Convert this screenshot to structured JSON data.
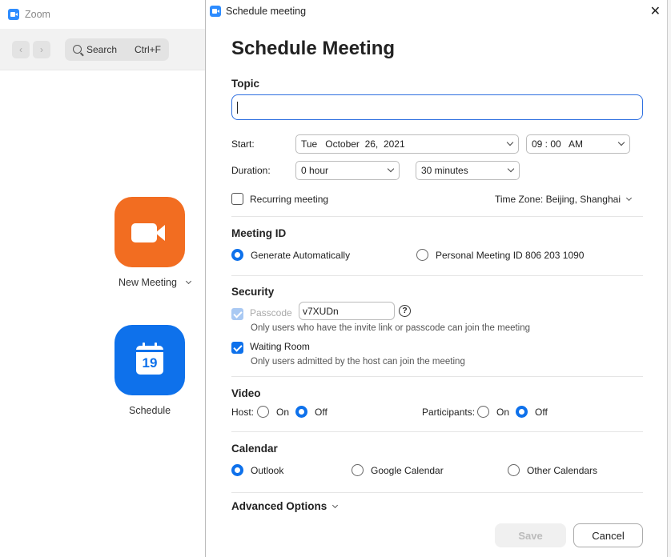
{
  "background_app": {
    "title": "Zoom",
    "search_label": "Search",
    "search_shortcut": "Ctrl+F",
    "back_icon": "chevron-left-icon",
    "forward_icon": "chevron-right-icon",
    "new_meeting_label": "New Meeting",
    "new_meeting_color": "#f26d21",
    "schedule_label": "Schedule",
    "schedule_color": "#0e71eb",
    "calendar_day": "19"
  },
  "dialog": {
    "window_title": "Schedule meeting",
    "close_glyph": "✕",
    "heading": "Schedule Meeting",
    "topic": {
      "label": "Topic",
      "value": ""
    },
    "start": {
      "label": "Start:",
      "date": "Tue   October  26,  2021",
      "time": "09 : 00   AM"
    },
    "duration": {
      "label": "Duration:",
      "hours": "0 hour",
      "minutes": "30 minutes"
    },
    "recurring": {
      "label": "Recurring meeting",
      "checked": false
    },
    "timezone": "Time Zone: Beijing, Shanghai",
    "meeting_id": {
      "label": "Meeting ID",
      "auto": "Generate Automatically",
      "personal": "Personal Meeting ID 806 203 1090",
      "selected": "auto"
    },
    "security": {
      "label": "Security",
      "passcode_label": "Passcode",
      "passcode_value": "v7XUDn",
      "passcode_help": "?",
      "passcode_hint": "Only users who have the invite link or passcode can join the meeting",
      "waiting_room_label": "Waiting Room",
      "waiting_room_hint": "Only users admitted by the host can join the meeting"
    },
    "video": {
      "label": "Video",
      "host_label": "Host:",
      "participants_label": "Participants:",
      "on": "On",
      "off": "Off",
      "host": "off",
      "participants": "off"
    },
    "calendar": {
      "label": "Calendar",
      "outlook": "Outlook",
      "google": "Google Calendar",
      "other": "Other Calendars",
      "selected": "outlook"
    },
    "advanced": "Advanced Options",
    "save_label": "Save",
    "cancel_label": "Cancel",
    "accent_color": "#0e71eb"
  }
}
